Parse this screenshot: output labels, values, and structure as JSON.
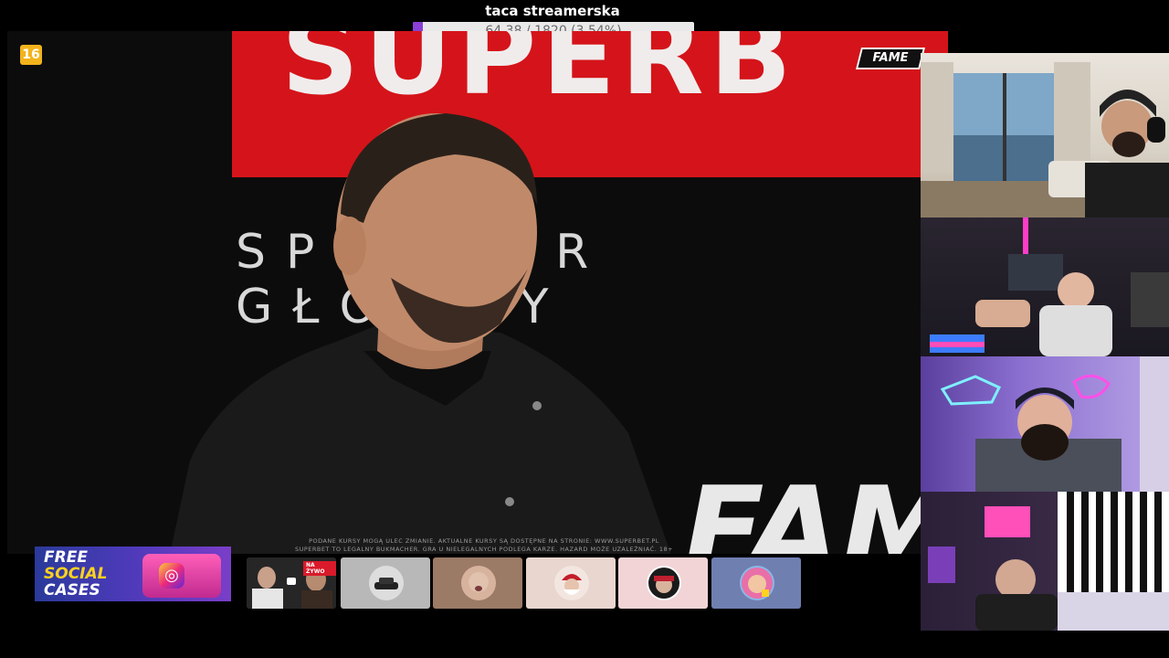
{
  "goal": {
    "title": "taca streamerska",
    "progress_text": "64.38 / 1820 (3.54%)",
    "progress_fraction": 0.0354,
    "fill_color": "#8a3fd6"
  },
  "stream": {
    "age_rating": "16",
    "broadcaster_logo": "FAME",
    "banner_text": "SUPERB",
    "sponsor_text": "SPONSOR GŁÓWNY",
    "background_logo": "FAME",
    "disclaimer_line1": "PODANE KURSY MOGĄ ULEC ZMIANIE. AKTUALNE KURSY SĄ DOSTĘPNE NA STRONIE: WWW.SUPERBET.PL",
    "disclaimer_line2": "SUPERBET TO LEGALNY BUKMACHER. GRA U NIELEGALNYCH PODLEGA KARZE. HAZARD MOŻE UZALEŻNIAĆ. 18+",
    "accent_color": "#d4141a"
  },
  "promo": {
    "line1": "FREE",
    "line2": "SOCIAL",
    "line3": "CASES",
    "icon": "instagram-icon"
  },
  "thumbnails": [
    {
      "name": "thumb-live",
      "bg": "#3a3a3a",
      "live_label": "NA ŻYWO"
    },
    {
      "name": "thumb-car",
      "bg": "#b8b8b8"
    },
    {
      "name": "thumb-face",
      "bg": "#9b7a66"
    },
    {
      "name": "thumb-santa",
      "bg": "#e8d6cf"
    },
    {
      "name": "thumb-nfx",
      "bg": "#f2d4d6"
    },
    {
      "name": "thumb-avatar",
      "bg": "#6f7fb0"
    }
  ],
  "webcams": [
    "webcam-hotel-room",
    "webcam-gaming-room",
    "webcam-neon-room",
    "webcam-bedroom"
  ]
}
